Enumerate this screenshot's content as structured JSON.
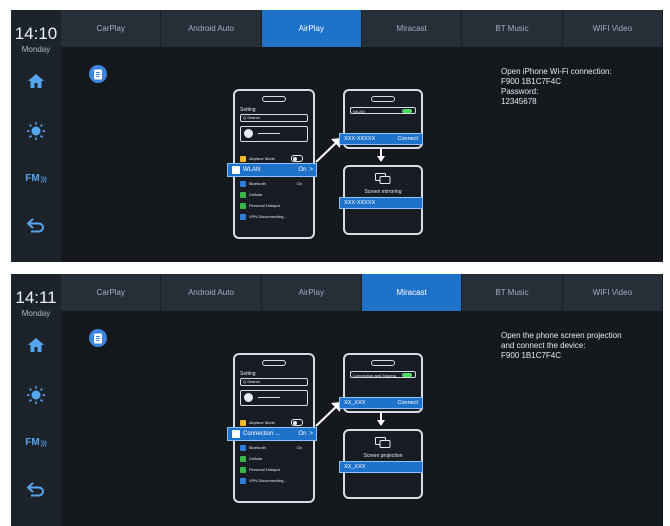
{
  "tabs": [
    "CarPlay",
    "Android Auto",
    "AirPlay",
    "Miracast",
    "BT Music",
    "WIFI Video"
  ],
  "screen1": {
    "time": "14:10",
    "day": "Monday",
    "active_tab": 2,
    "info_lines": [
      "Open iPhone Wi-Fi connection:",
      "F900 1B1C7F4C",
      "Password:",
      "12345678"
    ],
    "phone": {
      "title": "Setting",
      "search": "Q Search",
      "rows": [
        {
          "label": "Airplane Mode",
          "value": "",
          "color": "#f5b82e",
          "toggle": true
        },
        {
          "label": "Bluetooth",
          "value": "On",
          "color": "#2f7fd8",
          "toggle": false
        },
        {
          "label": "Cellular",
          "value": "",
          "color": "#39b54a",
          "toggle": false
        },
        {
          "label": "Personal Hotspot",
          "value": "",
          "color": "#39b54a",
          "toggle": false
        },
        {
          "label": "VPN Disconnecting...",
          "value": "",
          "color": "#2f7fd8",
          "toggle": false
        }
      ],
      "highlight_label": "WLAN",
      "highlight_value": "On"
    },
    "popup": {
      "label": "WLAN",
      "ssid": "XXX-XXXXX",
      "connect": "Connect"
    },
    "mirror": {
      "label": "Screen mirroring",
      "ssid": "XXX-XXXXX"
    }
  },
  "screen2": {
    "time": "14:11",
    "day": "Monday",
    "active_tab": 3,
    "info_lines": [
      "Open the phone screen projection",
      "and connect the device:",
      "F900 1B1C7F4C"
    ],
    "phone": {
      "title": "Setting",
      "search": "Q Search",
      "rows": [
        {
          "label": "Airplane Mode",
          "value": "",
          "color": "#f5b82e",
          "toggle": true
        },
        {
          "label": "Bluetooth",
          "value": "On",
          "color": "#2f7fd8",
          "toggle": false
        },
        {
          "label": "Cellular",
          "value": "",
          "color": "#39b54a",
          "toggle": false
        },
        {
          "label": "Personal Hotspot",
          "value": "",
          "color": "#39b54a",
          "toggle": false
        },
        {
          "label": "VPN Disconnecting...",
          "value": "",
          "color": "#2f7fd8",
          "toggle": false
        }
      ],
      "highlight_label": "Connection ...",
      "highlight_value": "On"
    },
    "popup": {
      "label": "Connection and Sharing",
      "ssid": "XX_XXX",
      "connect": "Connect"
    },
    "mirror": {
      "label": "Screen projection",
      "ssid": "XX_XXX"
    }
  },
  "sidebar_icons": [
    "home-icon",
    "brightness-icon",
    "fm-radio-icon",
    "back-icon"
  ],
  "fm_text": "FM",
  "colors": {
    "accent": "#1f72c9",
    "sidebar": "#1c232b",
    "tabbar": "#262e38",
    "background": "#15181d"
  }
}
